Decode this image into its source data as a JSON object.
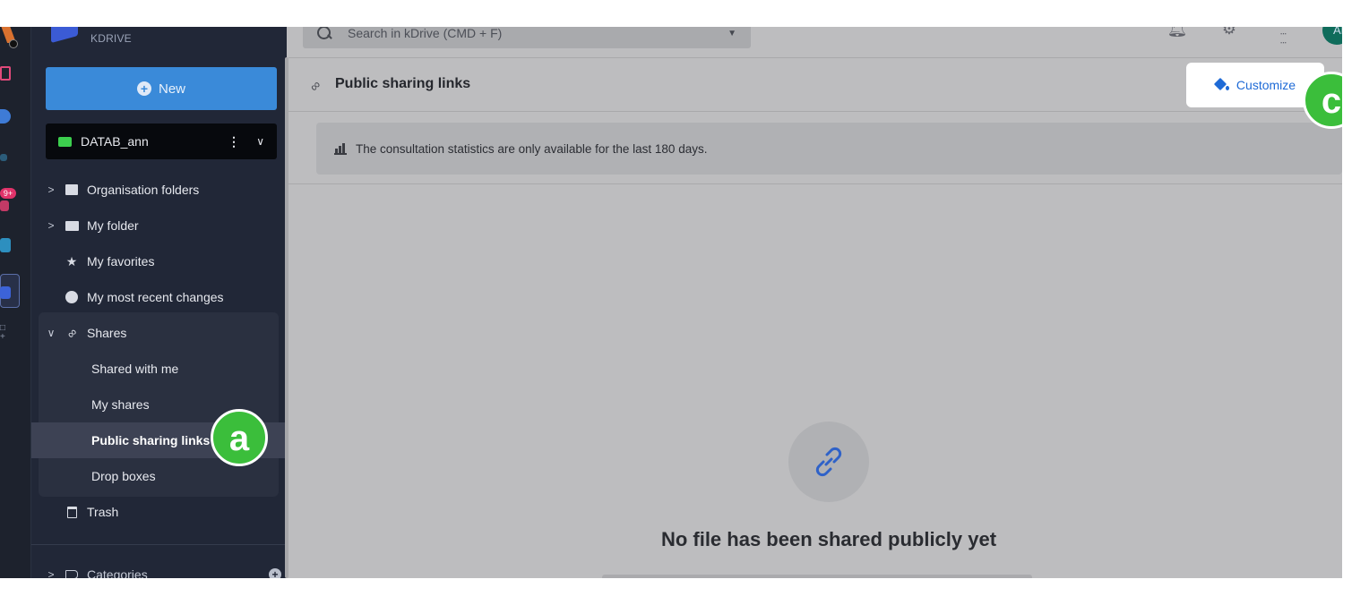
{
  "brand": {
    "name": "KDRIVE"
  },
  "sidebar": {
    "new_label": "New",
    "drive": {
      "name": "DATAB_ann",
      "more": "⋮",
      "chevron": "⌄"
    },
    "items": [
      {
        "label": "Organisation folders",
        "icon": "organisation-icon",
        "expandable": true
      },
      {
        "label": "My folder",
        "icon": "folder-icon",
        "expandable": true
      },
      {
        "label": "My favorites",
        "icon": "star-icon",
        "expandable": false
      },
      {
        "label": "My most recent changes",
        "icon": "clock-icon",
        "expandable": false
      }
    ],
    "shares": {
      "label": "Shares",
      "children": [
        "Shared with me",
        "My shares",
        "Public sharing links",
        "Drop boxes"
      ],
      "active": "Public sharing links"
    },
    "trash_label": "Trash",
    "categories_label": "Categories",
    "rail_badge": "9+"
  },
  "search": {
    "placeholder": "Search in kDrive (CMD + F)"
  },
  "header": {
    "avatar": "AN"
  },
  "page": {
    "title": "Public sharing links",
    "customize_label": "Customize",
    "stats_notice": "The consultation statistics are only available for the last 180 days.",
    "empty_title": "No file has been shared publicly yet"
  },
  "callouts": {
    "a": "a",
    "c": "c"
  },
  "colors": {
    "accent": "#3a8ad9",
    "sidebar": "#212737",
    "callout": "#3bbe3b",
    "link": "#1e6ad6"
  }
}
